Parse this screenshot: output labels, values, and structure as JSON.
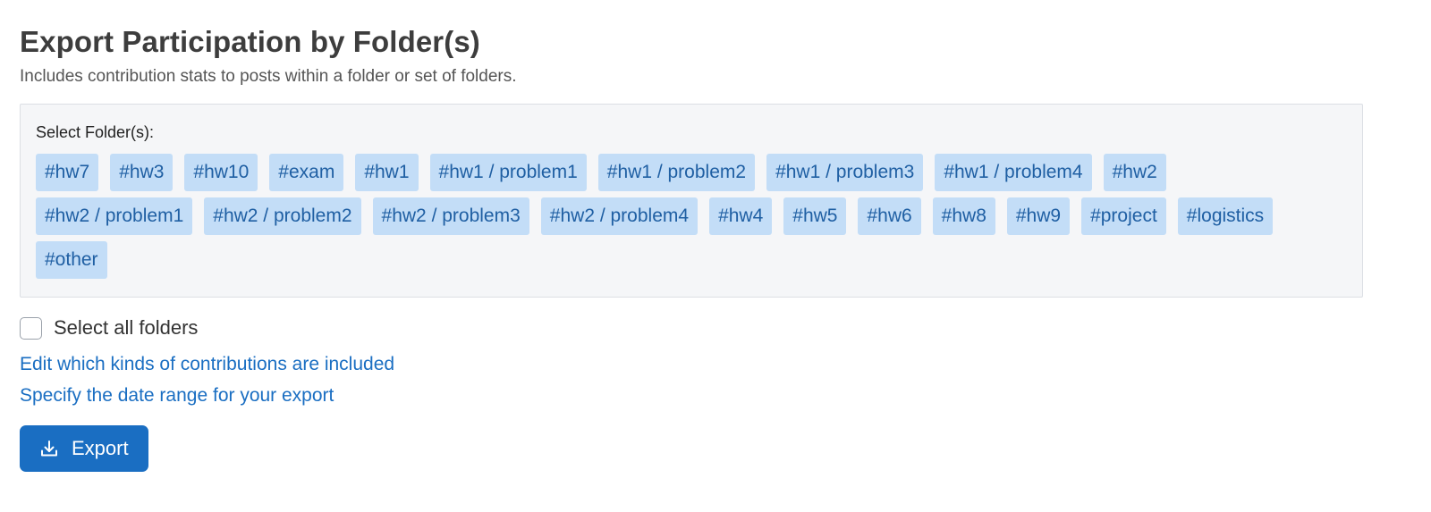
{
  "header": {
    "title": "Export Participation by Folder(s)",
    "subtitle": "Includes contribution stats to posts within a folder or set of folders."
  },
  "folders": {
    "label": "Select Folder(s):",
    "items": [
      "#hw7",
      "#hw3",
      "#hw10",
      "#exam",
      "#hw1",
      "#hw1 / problem1",
      "#hw1 / problem2",
      "#hw1 / problem3",
      "#hw1 / problem4",
      "#hw2",
      "#hw2 / problem1",
      "#hw2 / problem2",
      "#hw2 / problem3",
      "#hw2 / problem4",
      "#hw4",
      "#hw5",
      "#hw6",
      "#hw8",
      "#hw9",
      "#project",
      "#logistics",
      "#other"
    ]
  },
  "select_all": {
    "label": "Select all folders",
    "checked": false
  },
  "links": {
    "contributions": "Edit which kinds of contributions are included",
    "date_range": "Specify the date range for your export"
  },
  "export_button": {
    "label": "Export",
    "icon": "download-icon"
  },
  "colors": {
    "accent": "#1a6ec2",
    "tag_bg": "#c3ddf7",
    "tag_text": "#1f5fa3",
    "panel_bg": "#f5f6f8"
  }
}
